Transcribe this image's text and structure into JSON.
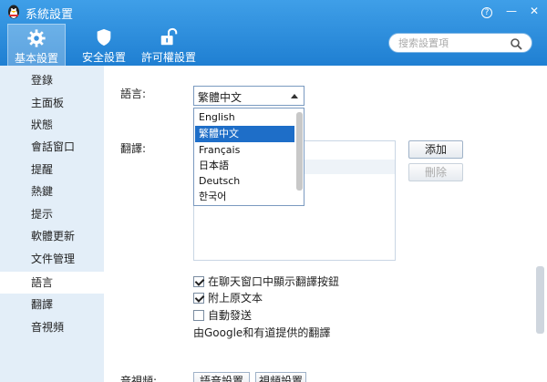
{
  "window": {
    "title": "系統設置",
    "help": "?",
    "minimize": "—",
    "close": "✕"
  },
  "tabs": [
    {
      "label": "基本設置",
      "icon": "gear-icon"
    },
    {
      "label": "安全設置",
      "icon": "shield-icon"
    },
    {
      "label": "許可權設置",
      "icon": "unlock-icon"
    }
  ],
  "search": {
    "placeholder": "搜索設置項"
  },
  "sidebar": {
    "items": [
      "登錄",
      "主面板",
      "狀態",
      "會話窗口",
      "提醒",
      "熱鍵",
      "提示",
      "軟體更新",
      "文件管理",
      "語言",
      "翻譯",
      "音視頻"
    ],
    "active_index": 9
  },
  "language": {
    "label": "語言:",
    "selected": "繁體中文",
    "options": [
      "English",
      "繁體中文",
      "Français",
      "日本語",
      "Deutsch",
      "한국어"
    ]
  },
  "translation": {
    "label": "翻譯:",
    "add_label": "添加",
    "delete_label": "刪除",
    "options": [
      {
        "label": "在聊天窗口中顯示翻譯按鈕",
        "checked": true
      },
      {
        "label": "附上原文本",
        "checked": true
      },
      {
        "label": "自動發送",
        "checked": false
      }
    ],
    "provider_note": "由Google和有道提供的翻譯"
  },
  "av": {
    "label": "音視頻:",
    "btn1": "語音設置",
    "btn2": "視頻設置"
  },
  "colors": {
    "accent": "#1f7fd2",
    "selection": "#1e6ec8",
    "sidebar_bg": "#e3eef8"
  }
}
